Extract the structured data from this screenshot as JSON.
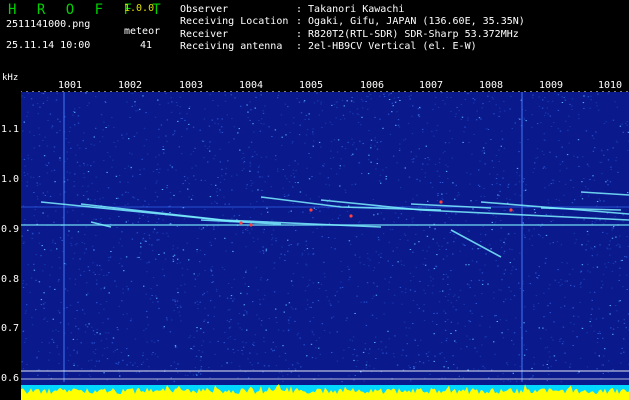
{
  "header": {
    "app_name": "H R O F F T",
    "version": "1.0.0",
    "filename": "2511141000.png",
    "datetime": "25.11.14 10:00",
    "meteor_label": "meteor",
    "meteor_count": "41"
  },
  "info": [
    {
      "label": "Observer",
      "value": ": Takanori Kawachi"
    },
    {
      "label": "Receiving Location",
      "value": ": Ogaki, Gifu, JAPAN (136.60E, 35.35N)"
    },
    {
      "label": "Receiver",
      "value": ": R820T2(RTL-SDR) SDR-Sharp 53.372MHz"
    },
    {
      "label": "Receiving antenna",
      "value": ": 2el-HB9CV Vertical (el. E-W)"
    }
  ],
  "spectrogram": {
    "y_unit": "kHz",
    "y_ticks": [
      "1.1",
      "1.0",
      "0.9",
      "0.8",
      "0.7",
      "0.6"
    ],
    "x_ticks": [
      "1001",
      "1002",
      "1003",
      "1004",
      "1005",
      "1006",
      "1007",
      "1008",
      "1009",
      "1010"
    ],
    "colors": {
      "background": "#0a1a8c",
      "noise_bright": "#5ab4ff",
      "trail": "#7cf0ff",
      "hot": "#ff4040",
      "signal_bar": "#ffff00",
      "axis_text": "#ffffff",
      "title": "#00d000"
    }
  }
}
